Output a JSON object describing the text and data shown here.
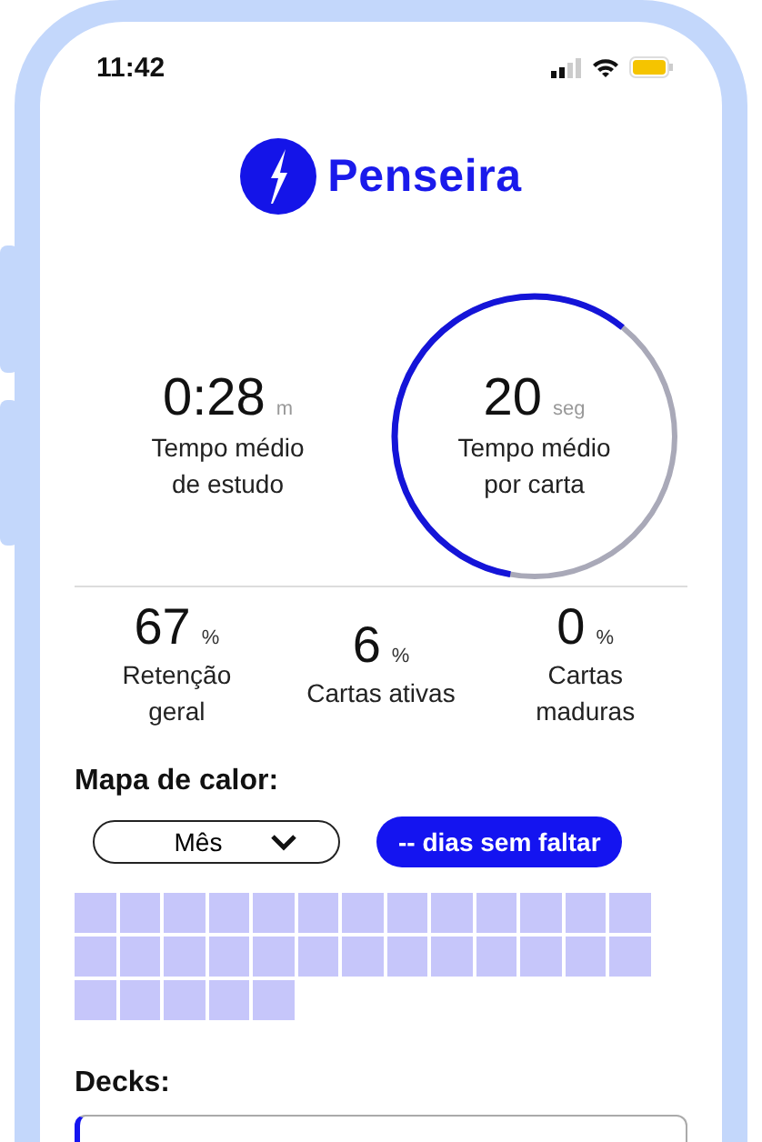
{
  "status_bar": {
    "time": "11:42"
  },
  "brand": {
    "name": "Penseira"
  },
  "top_stats": [
    {
      "value": "0:28",
      "unit": "m",
      "label": "Tempo médio de estudo",
      "kind": "plain"
    },
    {
      "value": "20",
      "unit": "seg",
      "label": "Tempo médio por carta",
      "kind": "ring",
      "level": 0.58
    }
  ],
  "stats": [
    {
      "value": "67",
      "unit": "%",
      "label": "Retenção geral"
    },
    {
      "value": "6",
      "unit": "%",
      "label": "Cartas ativas"
    },
    {
      "value": "0",
      "unit": "%",
      "label": "Cartas maduras"
    }
  ],
  "heatmap": {
    "title": "Mapa de calor:",
    "period": "Mês",
    "streak": "-- dias sem faltar",
    "cells": [
      {
        "kind": "day"
      },
      {
        "kind": "day"
      },
      {
        "kind": "day"
      },
      {
        "kind": "day"
      },
      {
        "kind": "day"
      },
      {
        "kind": "day"
      },
      {
        "kind": "day"
      },
      {
        "kind": "day"
      },
      {
        "kind": "day"
      },
      {
        "kind": "day"
      },
      {
        "kind": "day"
      },
      {
        "kind": "day"
      },
      {
        "kind": "day"
      },
      {
        "kind": "day"
      },
      {
        "kind": "day"
      },
      {
        "kind": "day"
      },
      {
        "kind": "day"
      },
      {
        "kind": "day"
      },
      {
        "kind": "day"
      },
      {
        "kind": "day"
      },
      {
        "kind": "day"
      },
      {
        "kind": "day"
      },
      {
        "kind": "day"
      },
      {
        "kind": "day"
      },
      {
        "kind": "day"
      },
      {
        "kind": "day"
      },
      {
        "kind": "day"
      },
      {
        "kind": "day"
      },
      {
        "kind": "day"
      },
      {
        "kind": "day"
      },
      {
        "kind": "day"
      }
    ]
  },
  "decks": {
    "title": "Decks:"
  }
}
